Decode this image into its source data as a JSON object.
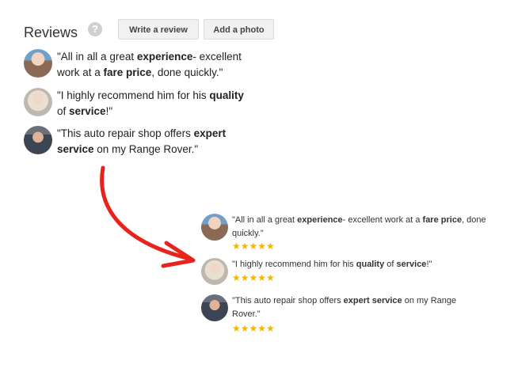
{
  "top": {
    "title": "Reviews",
    "help_symbol": "?",
    "buttons": {
      "write": "Write a review",
      "photo": "Add a photo"
    },
    "reviews": [
      {
        "avatar": "reviewer-1",
        "line1_prefix": "\"All in all a great ",
        "line1_bold": "experience",
        "line1_suffix": "- excellent",
        "line2_prefix": "work at a ",
        "line2_bold": "fare price",
        "line2_suffix": ", done quickly.\""
      },
      {
        "avatar": "reviewer-2",
        "line1_prefix": "\"I highly recommend him for his ",
        "line1_bold": "quality",
        "line2_prefix": "of ",
        "line2_bold": "service",
        "line2_suffix": "!\""
      },
      {
        "avatar": "reviewer-3",
        "line1_prefix": "\"This auto repair shop offers ",
        "line1_bold": "expert",
        "line2_bold": "service",
        "line2_suffix": " on my Range Rover.\""
      }
    ]
  },
  "bottom": {
    "reviews": [
      {
        "p1": "\"All in all a great ",
        "b1": "experience",
        "p2": "- excellent work at a ",
        "b2": "fare price",
        "p3": ", done quickly.\"",
        "stars": "★★★★★"
      },
      {
        "p1": "\"I highly recommend him for his ",
        "b1": "quality",
        "p2": " of ",
        "b2": "service",
        "p3": "!\"",
        "stars": "★★★★★"
      },
      {
        "p1": "\"This auto repair shop offers ",
        "b1": "expert service",
        "p2": " on my Range Rover.\"",
        "stars": "★★★★★"
      }
    ]
  },
  "colors": {
    "arrow": "#e8231d",
    "stars": "#f4b400"
  }
}
